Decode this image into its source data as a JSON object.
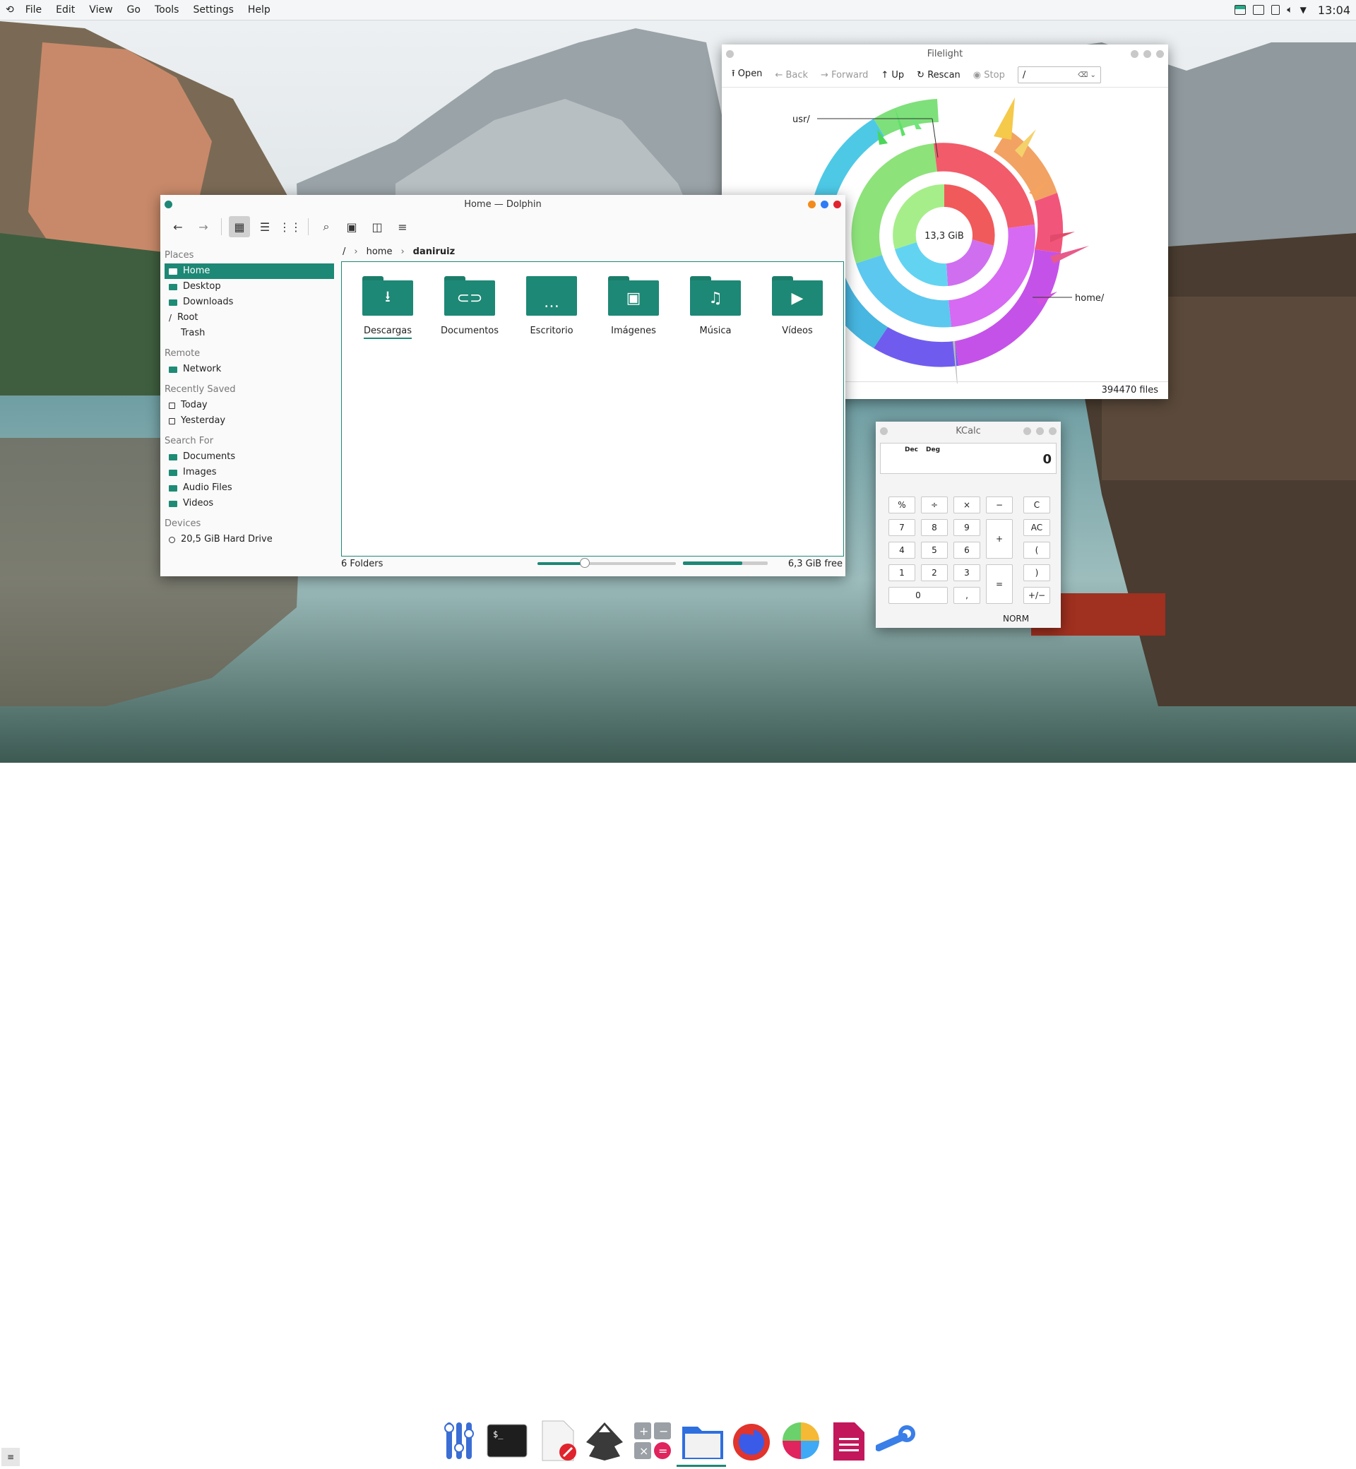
{
  "topbar": {
    "menu": [
      "File",
      "Edit",
      "View",
      "Go",
      "Tools",
      "Settings",
      "Help"
    ],
    "clock": "13:04"
  },
  "dolphin": {
    "title": "Home — Dolphin",
    "places": {
      "places_header": "Places",
      "places_items": [
        "Home",
        "Desktop",
        "Downloads",
        "Root",
        "Trash"
      ],
      "remote_header": "Remote",
      "remote_items": [
        "Network"
      ],
      "recent_header": "Recently Saved",
      "recent_items": [
        "Today",
        "Yesterday"
      ],
      "search_header": "Search For",
      "search_items": [
        "Documents",
        "Images",
        "Audio Files",
        "Videos"
      ],
      "devices_header": "Devices",
      "devices_items": [
        "20,5 GiB Hard Drive"
      ]
    },
    "breadcrumb": [
      "/",
      "home",
      "daniruiz"
    ],
    "folders": [
      {
        "name": "Descargas",
        "icon": "download-icon"
      },
      {
        "name": "Documentos",
        "icon": "paperclip-icon"
      },
      {
        "name": "Escritorio",
        "icon": "desktop-icon"
      },
      {
        "name": "Imágenes",
        "icon": "image-icon"
      },
      {
        "name": "Música",
        "icon": "music-icon"
      },
      {
        "name": "Vídeos",
        "icon": "video-icon"
      }
    ],
    "status_left": "6 Folders",
    "zoom_level": 0.34,
    "disk_used_fraction": 0.7,
    "free_space": "6,3 GiB free"
  },
  "filelight": {
    "title": "Filelight",
    "toolbar": {
      "open": "Open",
      "back": "Back",
      "forward": "Forward",
      "up": "Up",
      "rescan": "Rescan",
      "stop": "Stop"
    },
    "path": "/",
    "center_label": "13,3 GiB",
    "label_usr": "usr/",
    "label_home": "home/",
    "status": "394470 files"
  },
  "kcalc": {
    "title": "KCalc",
    "mode1": "Dec",
    "mode2": "Deg",
    "display": "0",
    "keys": {
      "percent": "%",
      "divide": "÷",
      "multiply": "×",
      "minus": "−",
      "clear": "C",
      "seven": "7",
      "eight": "8",
      "nine": "9",
      "plus": "+",
      "allclear": "AC",
      "four": "4",
      "five": "5",
      "six": "6",
      "lparen": "(",
      "one": "1",
      "two": "2",
      "three": "3",
      "equals": "=",
      "rparen": ")",
      "zero": "0",
      "comma": ",",
      "sign": "+/−"
    },
    "norm": "NORM"
  },
  "colors": {
    "accent": "#1d8875",
    "close": "#e0242d",
    "maximize": "#2e7cf6",
    "minimize": "#f28b1c"
  }
}
